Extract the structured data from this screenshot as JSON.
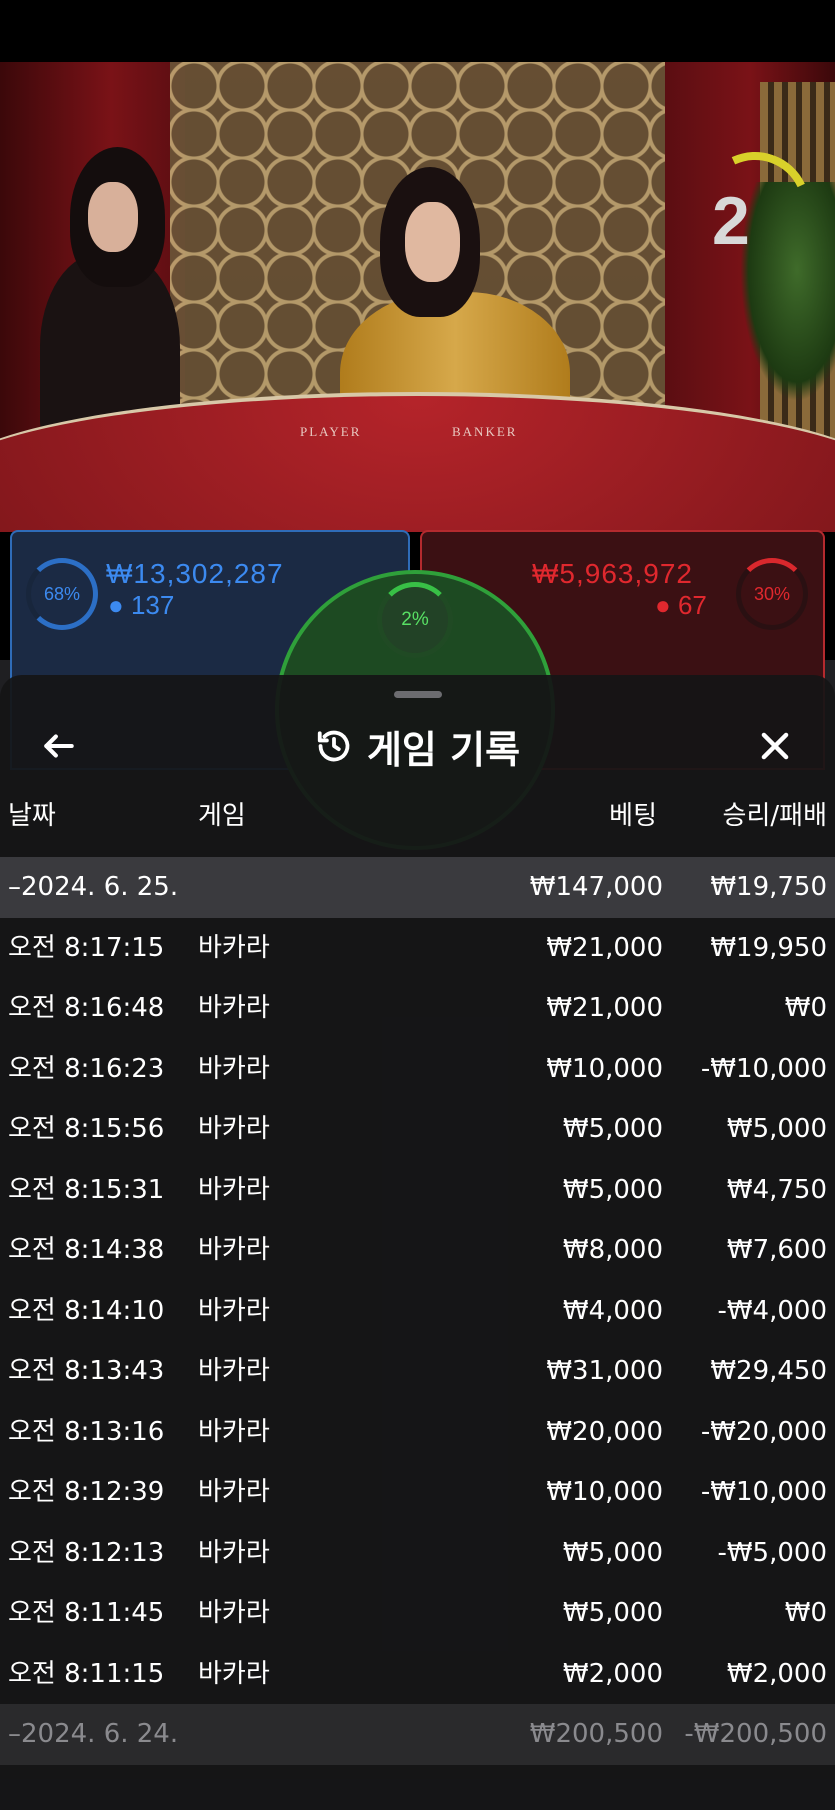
{
  "game_overlay": {
    "countdown": "2",
    "felt_left": "PLAYER",
    "felt_right": "BANKER",
    "player_pct": "68%",
    "player_amount": "₩13,302,287",
    "player_users": "137",
    "banker_pct": "30%",
    "banker_amount": "₩5,963,972",
    "banker_users": "67",
    "tie_pct": "2%"
  },
  "sheet": {
    "title": "게임 기록",
    "columns": {
      "date": "날짜",
      "game": "게임",
      "bet": "베팅",
      "result": "승리/패배"
    },
    "rows": [
      {
        "type": "date",
        "time": "–2024. 6. 25.",
        "game": "",
        "bet": "₩147,000",
        "result": "₩19,750"
      },
      {
        "type": "entry",
        "time": "오전 8:17:15",
        "game": "바카라",
        "bet": "₩21,000",
        "result": "₩19,950"
      },
      {
        "type": "entry",
        "time": "오전 8:16:48",
        "game": "바카라",
        "bet": "₩21,000",
        "result": "₩0"
      },
      {
        "type": "entry",
        "time": "오전 8:16:23",
        "game": "바카라",
        "bet": "₩10,000",
        "result": "-₩10,000"
      },
      {
        "type": "entry",
        "time": "오전 8:15:56",
        "game": "바카라",
        "bet": "₩5,000",
        "result": "₩5,000"
      },
      {
        "type": "entry",
        "time": "오전 8:15:31",
        "game": "바카라",
        "bet": "₩5,000",
        "result": "₩4,750"
      },
      {
        "type": "entry",
        "time": "오전 8:14:38",
        "game": "바카라",
        "bet": "₩8,000",
        "result": "₩7,600"
      },
      {
        "type": "entry",
        "time": "오전 8:14:10",
        "game": "바카라",
        "bet": "₩4,000",
        "result": "-₩4,000"
      },
      {
        "type": "entry",
        "time": "오전 8:13:43",
        "game": "바카라",
        "bet": "₩31,000",
        "result": "₩29,450"
      },
      {
        "type": "entry",
        "time": "오전 8:13:16",
        "game": "바카라",
        "bet": "₩20,000",
        "result": "-₩20,000"
      },
      {
        "type": "entry",
        "time": "오전 8:12:39",
        "game": "바카라",
        "bet": "₩10,000",
        "result": "-₩10,000"
      },
      {
        "type": "entry",
        "time": "오전 8:12:13",
        "game": "바카라",
        "bet": "₩5,000",
        "result": "-₩5,000"
      },
      {
        "type": "entry",
        "time": "오전 8:11:45",
        "game": "바카라",
        "bet": "₩5,000",
        "result": "₩0"
      },
      {
        "type": "entry",
        "time": "오전 8:11:15",
        "game": "바카라",
        "bet": "₩2,000",
        "result": "₩2,000"
      },
      {
        "type": "date-faded",
        "time": "–2024. 6. 24.",
        "game": "",
        "bet": "₩200,500",
        "result": "-₩200,500"
      }
    ]
  },
  "icons": {
    "back": "arrow-left-icon",
    "history": "history-icon",
    "close": "close-icon"
  }
}
